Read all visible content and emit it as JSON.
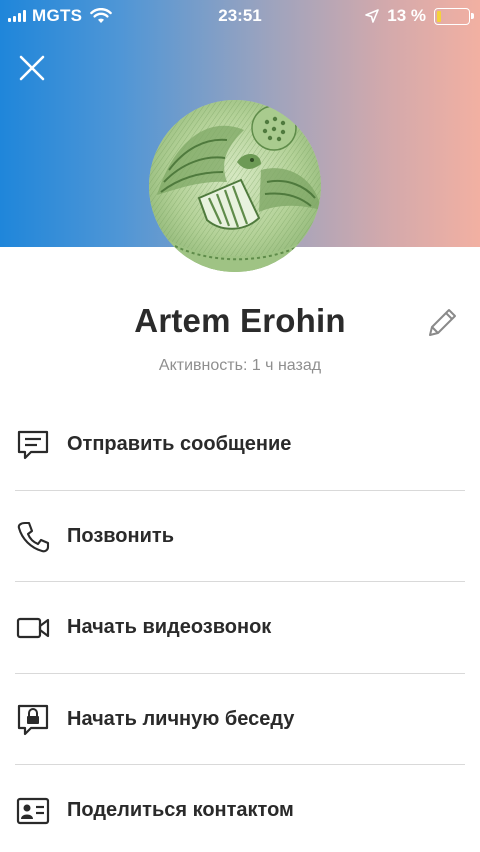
{
  "status_bar": {
    "carrier": "MGTS",
    "time": "23:51",
    "battery": "13 %",
    "battery_level": 0.13
  },
  "profile": {
    "name": "Artem Erohin",
    "activity": "Активность: 1 ч назад"
  },
  "menu": [
    {
      "label": "Отправить сообщение",
      "icon": "message-icon"
    },
    {
      "label": "Позвонить",
      "icon": "phone-icon"
    },
    {
      "label": "Начать видеозвонок",
      "icon": "video-camera-icon"
    },
    {
      "label": "Начать личную беседу",
      "icon": "locked-chat-icon"
    },
    {
      "label": "Поделиться контактом",
      "icon": "contact-card-icon"
    }
  ],
  "colors": {
    "header_gradient_start": "#1f86da",
    "header_gradient_end": "#f2b0a2",
    "battery_fill": "#f5d33b",
    "avatar_tint": "#bcd7a3"
  }
}
